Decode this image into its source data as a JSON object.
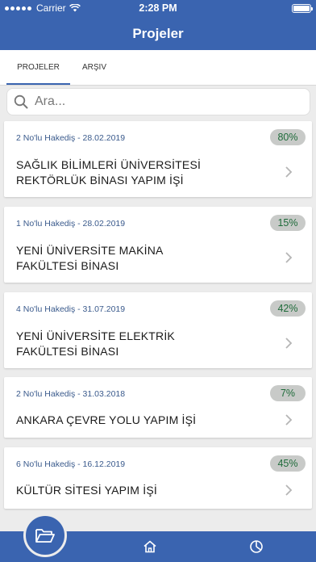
{
  "status": {
    "carrier": "Carrier",
    "time": "2:28 PM"
  },
  "nav": {
    "title": "Projeler"
  },
  "tabs": [
    {
      "label": "PROJELER"
    },
    {
      "label": "ARŞIV"
    }
  ],
  "search": {
    "placeholder": "Ara..."
  },
  "projects": [
    {
      "meta": "2 No'lu Hakediş - 28.02.2019",
      "percent": "80%",
      "name_line1": "SAĞLIK BİLİMLERİ ÜNİVERSİTESİ",
      "name_line2": "REKTÖRLÜK BİNASI YAPIM İŞİ"
    },
    {
      "meta": "1 No'lu Hakediş - 28.02.2019",
      "percent": "15%",
      "name_line1": "YENİ ÜNİVERSİTE MAKİNA",
      "name_line2": "FAKÜLTESİ BİNASI"
    },
    {
      "meta": "4 No'lu Hakediş - 31.07.2019",
      "percent": "42%",
      "name_line1": "YENİ ÜNİVERSİTE ELEKTRİK",
      "name_line2": "FAKÜLTESİ BİNASI"
    },
    {
      "meta": "2 No'lu Hakediş - 31.03.2018",
      "percent": "7%",
      "name_line1": "ANKARA ÇEVRE YOLU YAPIM İŞİ",
      "name_line2": ""
    },
    {
      "meta": "6 No'lu Hakediş - 16.12.2019",
      "percent": "45%",
      "name_line1": "KÜLTÜR SİTESİ YAPIM İŞİ",
      "name_line2": ""
    }
  ],
  "icons": {
    "wifi": "wifi-icon",
    "battery": "battery-icon",
    "search": "search-icon",
    "chevron": "chevron-right-icon",
    "folder": "folder-open-icon",
    "home": "home-icon",
    "chart": "pie-chart-icon"
  },
  "colors": {
    "primary": "#3a64b0",
    "badge_bg": "#c8cac8",
    "badge_text": "#1f6b3a",
    "meta_text": "#3a5a8c"
  }
}
